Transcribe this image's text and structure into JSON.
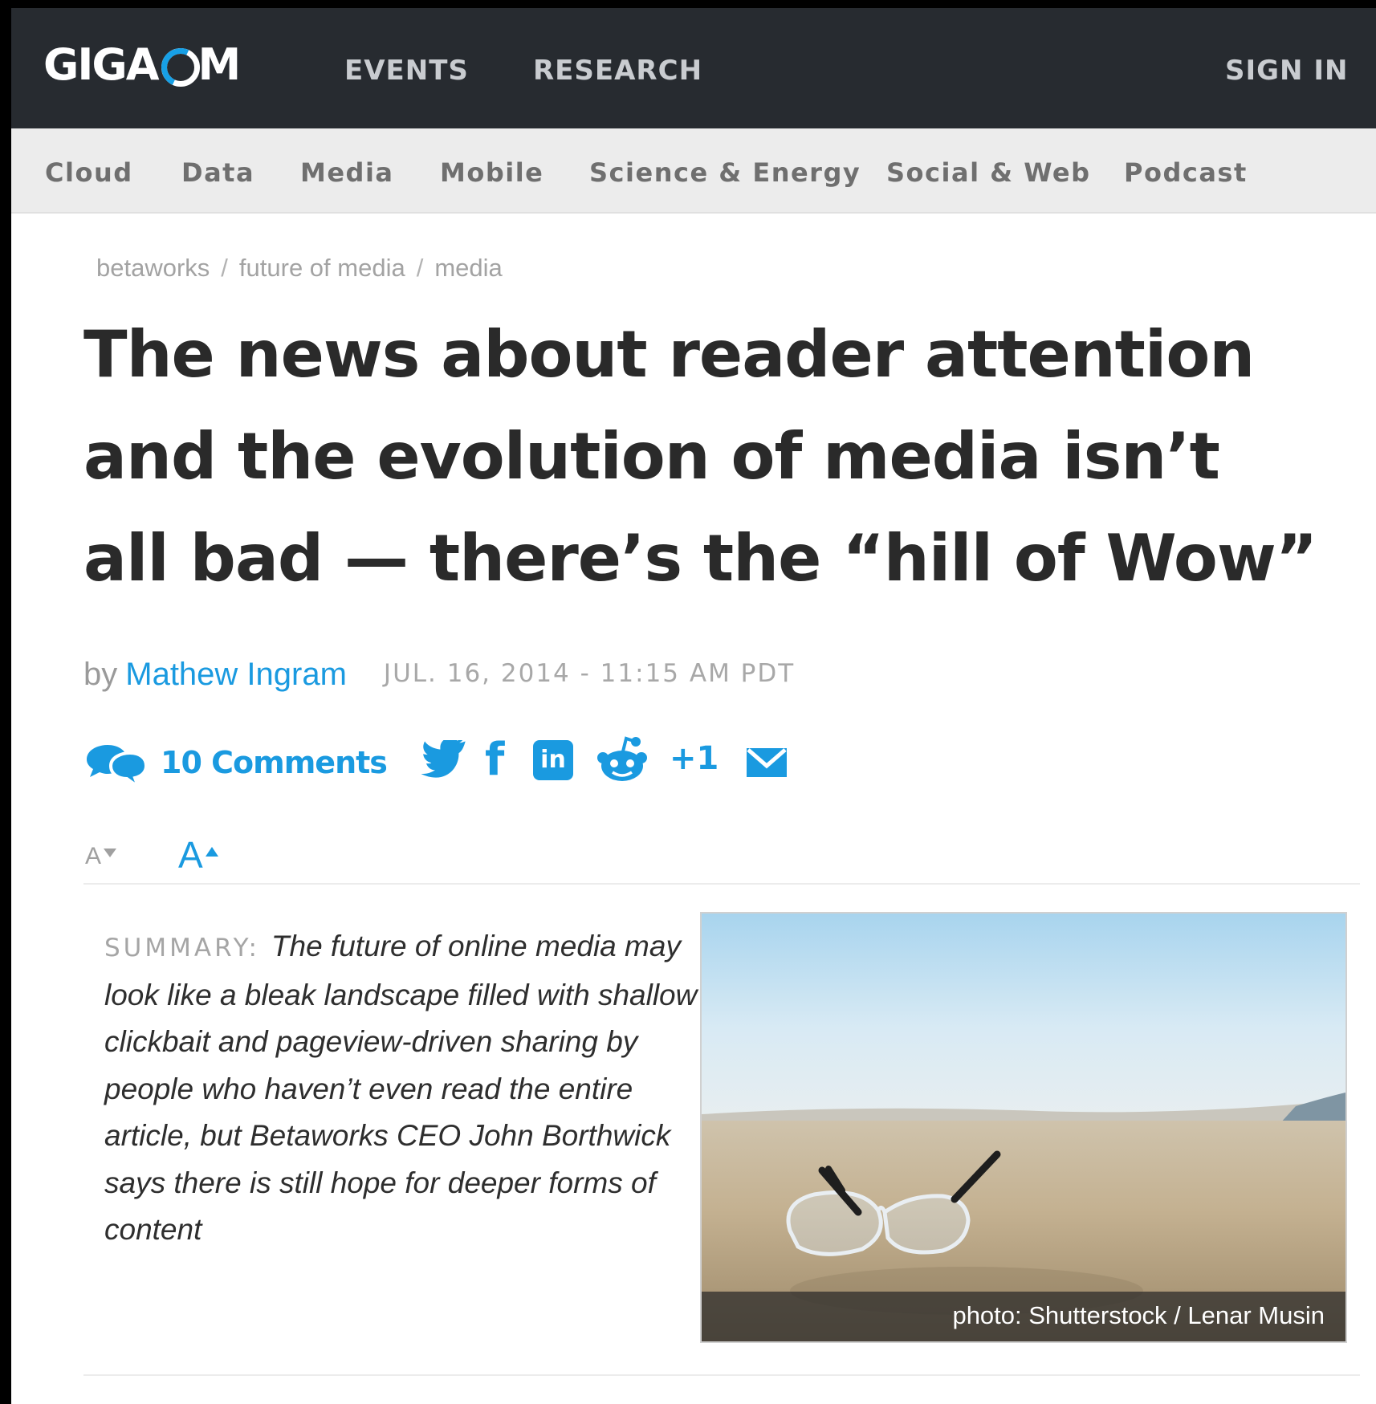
{
  "brand": {
    "logo_left": "GIGA",
    "logo_right": "M"
  },
  "topnav": {
    "events": "EVENTS",
    "research": "RESEARCH",
    "signin": "SIGN IN"
  },
  "categories": [
    "Cloud",
    "Data",
    "Media",
    "Mobile",
    "Science & Energy",
    "Social & Web",
    "Podcast"
  ],
  "breadcrumbs": [
    "betaworks",
    "future of media",
    "media"
  ],
  "breadcrumb_separator": "/",
  "article": {
    "title_lines": [
      "The news about reader attention",
      "and the evolution of media isn’t",
      "all bad — there’s the “hill of Wow”"
    ],
    "by": "by",
    "author": "Mathew Ingram",
    "date": "JUL. 16, 2014 - 11:15 AM PDT"
  },
  "social": {
    "comments_label": "10 Comments",
    "facebook_glyph": "f",
    "linkedin_glyph": "in",
    "plus_one": "+1",
    "icons": [
      "comments-icon",
      "twitter-icon",
      "facebook-icon",
      "linkedin-icon",
      "reddit-icon",
      "google-plus-icon",
      "email-icon"
    ],
    "accent_color": "#1a9ae0"
  },
  "font_controls": {
    "small": "A",
    "large": "A"
  },
  "summary": {
    "label": "SUMMARY:",
    "text": "The future of online media may look like a bleak landscape filled with shallow clickbait and pageview-driven sharing by people who haven’t even read the entire article, but Betaworks CEO John Borthwick says there is still hope for deeper forms of content"
  },
  "photo": {
    "caption": "photo: Shutterstock / Lenar Musin"
  },
  "colors": {
    "topbar": "#272b30",
    "catbar": "#ececec",
    "link": "#1a9ae0"
  }
}
